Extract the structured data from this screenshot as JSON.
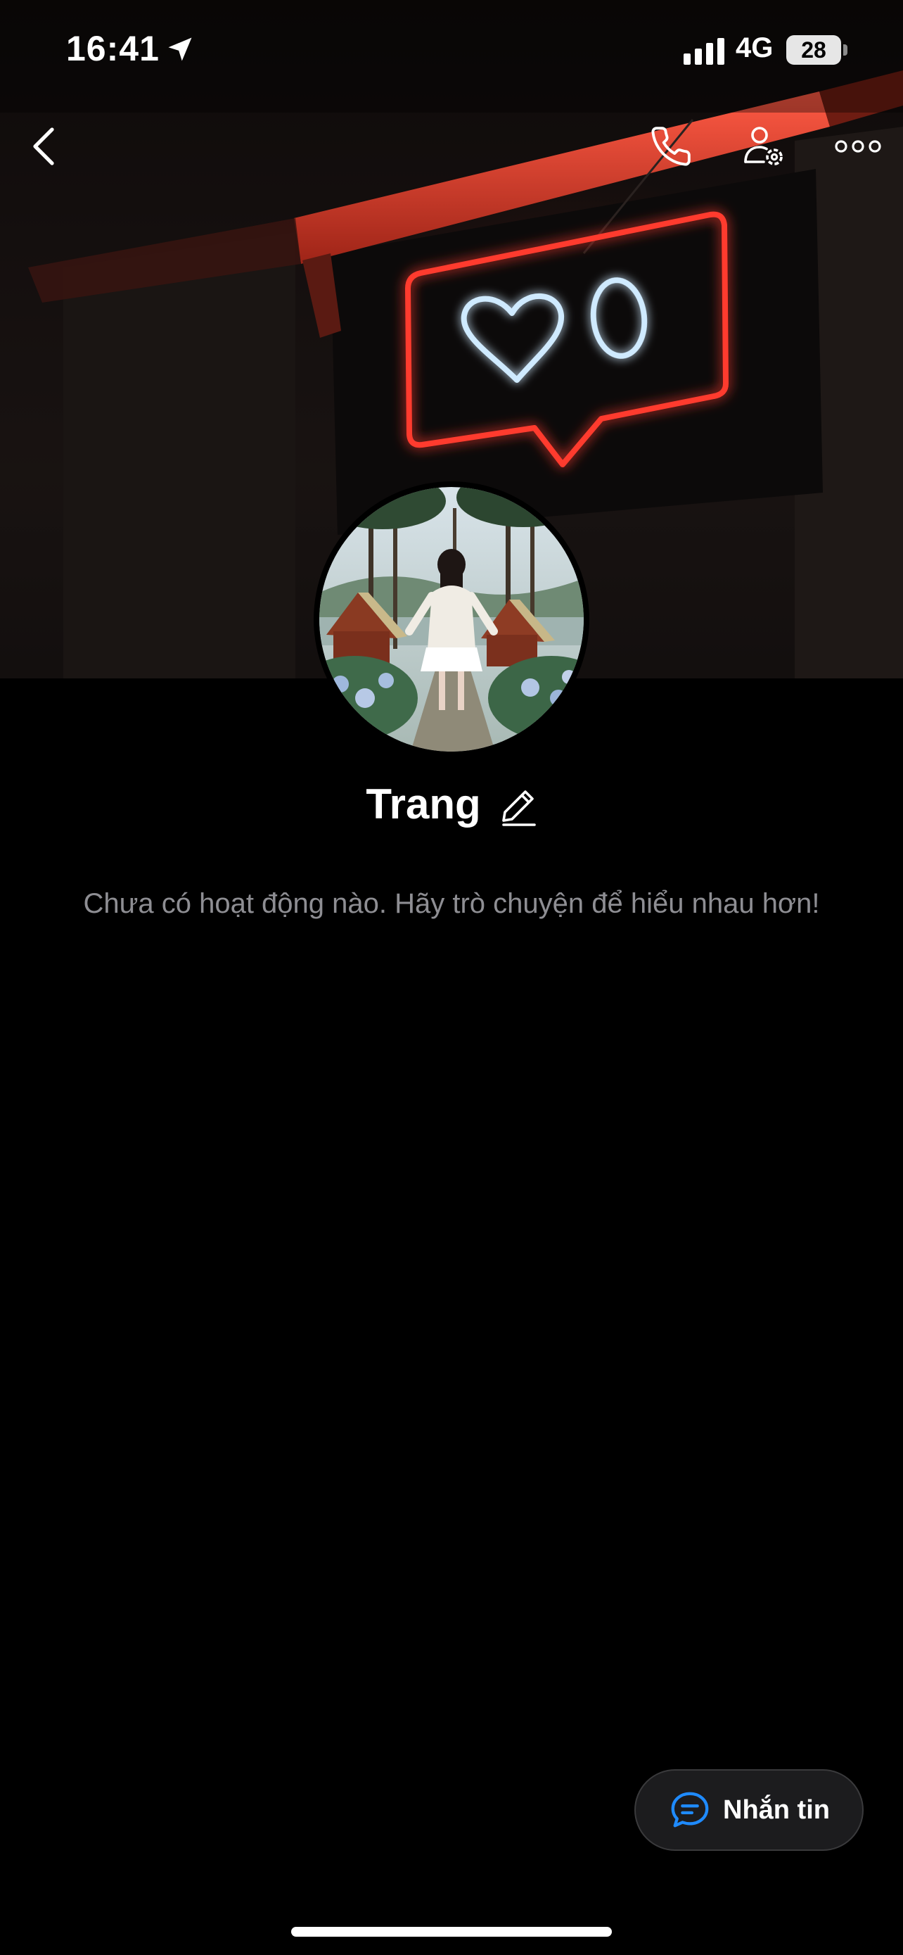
{
  "status_bar": {
    "time": "16:41",
    "network": "4G",
    "battery": "28",
    "icons": [
      "location-arrow-icon",
      "cellular-signal-icon"
    ]
  },
  "nav": {
    "icons": [
      "chevron-left-icon",
      "phone-icon",
      "user-settings-icon",
      "more-icon"
    ]
  },
  "profile": {
    "name": "Trang",
    "empty_activity": "Chưa có hoạt động nào. Hãy trò chuyện để hiểu nhau hơn!"
  },
  "actions": {
    "message_label": "Nhắn tin",
    "message_icon": "chat-bubble-icon"
  },
  "colors": {
    "background": "#000000",
    "accent": "#1f8bff",
    "neon_red": "#ff3b2f",
    "neon_blue": "#cfeaff",
    "secondary_text": "#8e8e93"
  }
}
